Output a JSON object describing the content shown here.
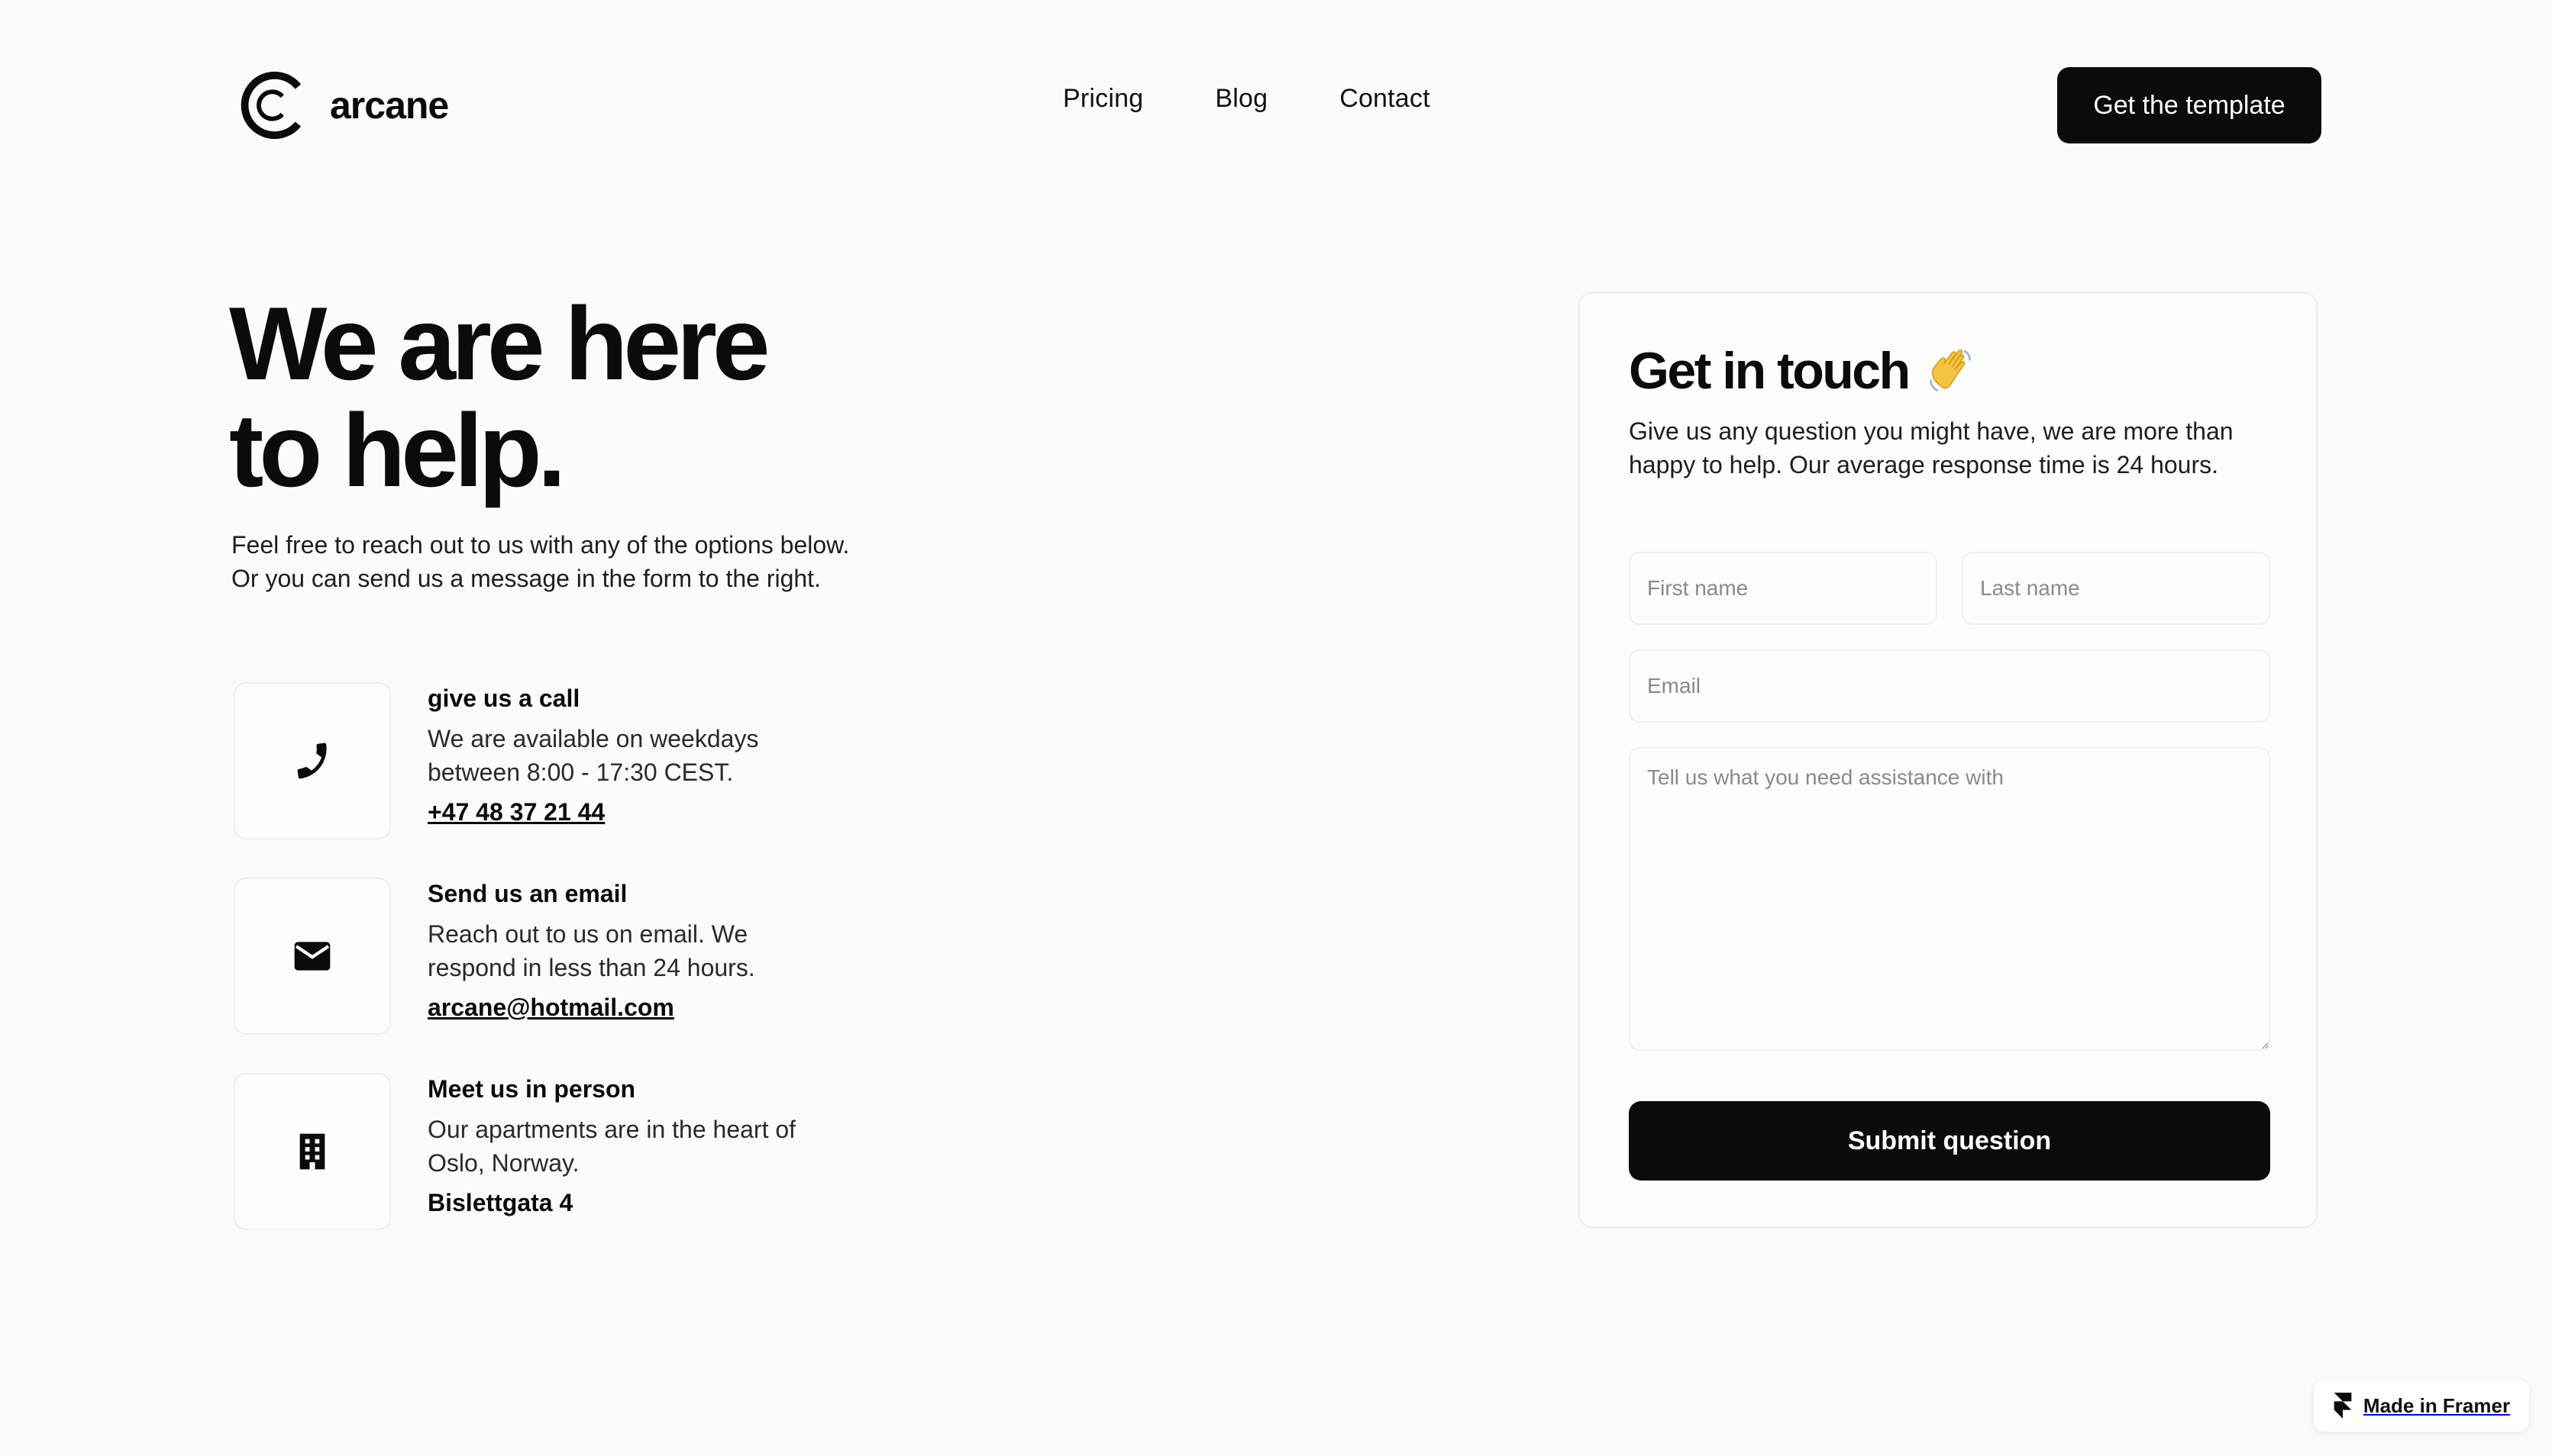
{
  "header": {
    "brand": "arcane",
    "nav": [
      {
        "label": "Pricing"
      },
      {
        "label": "Blog"
      },
      {
        "label": "Contact"
      }
    ],
    "cta_label": "Get the template"
  },
  "hero": {
    "title_line1": "We are here",
    "title_line2": "to help.",
    "subtitle_line1": "Feel free to reach out to us with any of the options below.",
    "subtitle_line2": "Or you can send us a message in the form to the right."
  },
  "contacts": [
    {
      "icon": "phone-icon",
      "title": "give us a call",
      "desc": "We are available on weekdays between 8:00 - 17:30 CEST.",
      "value": "+47 48 37 21 44"
    },
    {
      "icon": "mail-icon",
      "title": "Send us an email",
      "desc": "Reach out to us on email. We respond in less than 24 hours.",
      "value": "arcane@hotmail.com"
    },
    {
      "icon": "building-icon",
      "title": "Meet us in person",
      "desc": "Our apartments are in the heart of Oslo, Norway.",
      "value": "Bislettgata 4"
    }
  ],
  "form": {
    "title": "Get in touch",
    "emoji_icon": "waving-hand-icon",
    "subtitle": "Give us any question you might have, we are more than happy to help. Our average response time is 24 hours.",
    "first_name_placeholder": "First name",
    "last_name_placeholder": "Last name",
    "email_placeholder": "Email",
    "message_placeholder": "Tell us what you need assistance with",
    "submit_label": "Submit question"
  },
  "badge": {
    "label": "Made in Framer",
    "icon": "framer-logo-icon"
  },
  "colors": {
    "background": "#fbfbfb",
    "primary": "#0b0b0b",
    "border": "#f0f0f0"
  }
}
